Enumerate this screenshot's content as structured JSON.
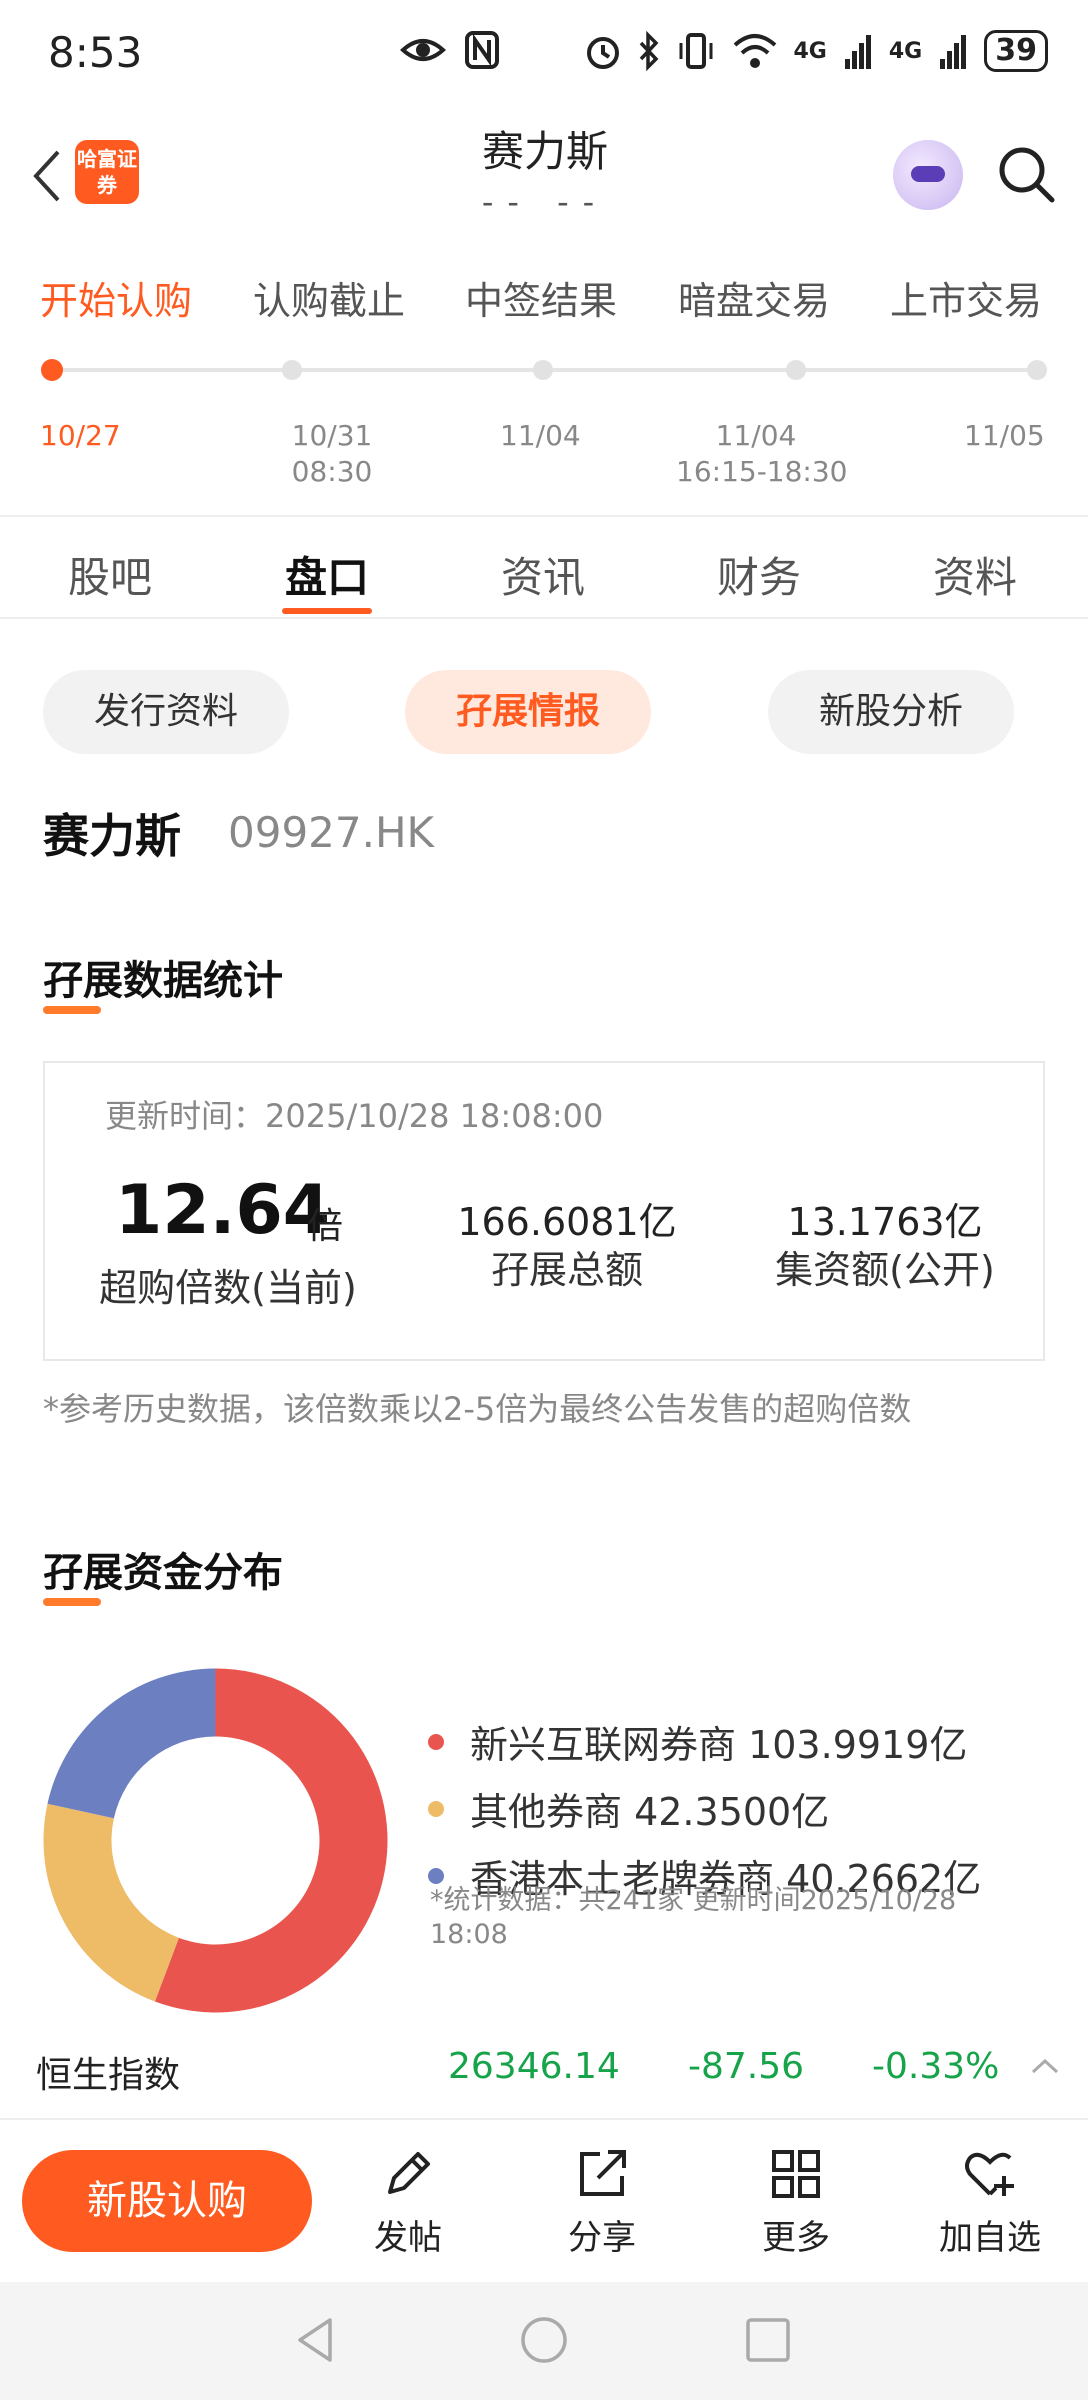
{
  "status_bar": {
    "time": "8:53",
    "network_1": "4G",
    "network_2": "4G",
    "battery": "39",
    "icons": [
      "eye-icon",
      "nfc-icon",
      "alarm-icon",
      "bluetooth-icon",
      "vibrate-icon",
      "wifi-icon",
      "signal-icon",
      "signal-icon",
      "battery-icon"
    ]
  },
  "header": {
    "logo_text": "哈富证券",
    "title": "赛力斯",
    "subtitle": "-- --"
  },
  "timeline": {
    "steps": [
      {
        "label": "开始认购",
        "date": "10/27",
        "time": "",
        "active": true
      },
      {
        "label": "认购截止",
        "date": "10/31",
        "time": "08:30",
        "active": false
      },
      {
        "label": "中签结果",
        "date": "11/04",
        "time": "",
        "active": false
      },
      {
        "label": "暗盘交易",
        "date": "11/04",
        "time": "16:15-18:30",
        "active": false
      },
      {
        "label": "上市交易",
        "date": "11/05",
        "time": "",
        "active": false
      }
    ]
  },
  "tabs": [
    {
      "label": "股吧",
      "active": false
    },
    {
      "label": "盘口",
      "active": true
    },
    {
      "label": "资讯",
      "active": false
    },
    {
      "label": "财务",
      "active": false
    },
    {
      "label": "资料",
      "active": false
    }
  ],
  "pills": [
    {
      "label": "发行资料",
      "active": false
    },
    {
      "label": "孖展情报",
      "active": true
    },
    {
      "label": "新股分析",
      "active": false
    }
  ],
  "stock": {
    "name": "赛力斯",
    "code": "09927.HK"
  },
  "margin_stats": {
    "section_title": "孖展数据统计",
    "update_time": "更新时间：2025/10/28 18:08:00",
    "oversubscription": "12.64",
    "oversubscription_unit": "倍",
    "oversubscription_label": "超购倍数(当前)",
    "margin_total": "166.6081亿",
    "margin_total_label": "孖展总额",
    "fundraise": "13.1763亿",
    "fundraise_label": "集资额(公开)",
    "note": "*参考历史数据，该倍数乘以2-5倍为最终公告发售的超购倍数"
  },
  "margin_distribution": {
    "section_title": "孖展资金分布",
    "note": "*统计数据：共241家 更新时间2025/10/28 18:08"
  },
  "chart_data": {
    "type": "pie",
    "categories": [
      "新兴互联网券商",
      "其他券商",
      "香港本土老牌券商"
    ],
    "values": [
      103.9919,
      42.35,
      40.2662
    ],
    "value_labels": [
      "103.9919亿",
      "42.3500亿",
      "40.2662亿"
    ],
    "colors": [
      "#e9554e",
      "#eebb67",
      "#6b7fc1"
    ],
    "donut": true
  },
  "index": {
    "name": "恒生指数",
    "value": "26346.14",
    "change": "-87.56",
    "change_pct": "-0.33%",
    "color": "#17a34a"
  },
  "bottom_bar": {
    "buy_label": "新股认购",
    "post_label": "发帖",
    "share_label": "分享",
    "more_label": "更多",
    "watch_label": "加自选"
  },
  "colors": {
    "accent": "#ff5a1f"
  }
}
